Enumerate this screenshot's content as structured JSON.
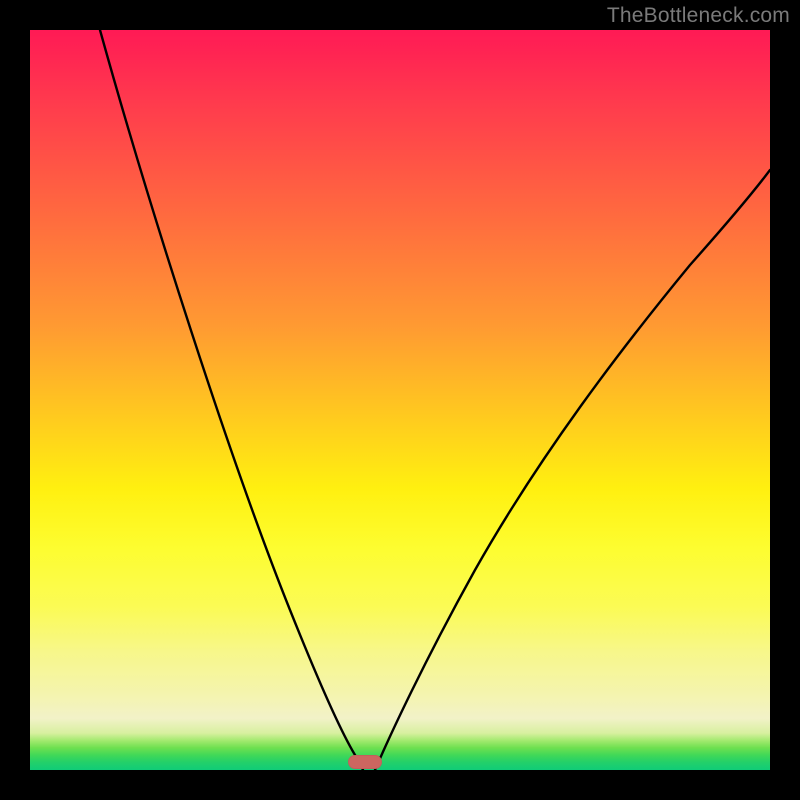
{
  "watermark": "TheBottleneck.com",
  "colors": {
    "frame": "#000000",
    "gradient_top": "#ff1a55",
    "gradient_mid": "#fff010",
    "gradient_bottom": "#10cc78",
    "curve": "#000000",
    "marker": "#cc6660"
  },
  "chart_data": {
    "type": "line",
    "title": "",
    "xlabel": "",
    "ylabel": "",
    "x": [
      0,
      0.05,
      0.1,
      0.15,
      0.2,
      0.25,
      0.3,
      0.35,
      0.4,
      0.45,
      0.5,
      0.55,
      0.6,
      0.65,
      0.7,
      0.75,
      0.8,
      0.85,
      0.9,
      0.95,
      1.0
    ],
    "xlim": [
      0,
      1
    ],
    "ylim": [
      0,
      1
    ],
    "series": [
      {
        "name": "left-branch",
        "values": [
          1.0,
          0.9,
          0.78,
          0.67,
          0.56,
          0.44,
          0.33,
          0.22,
          0.1,
          0.0,
          null,
          null,
          null,
          null,
          null,
          null,
          null,
          null,
          null,
          null,
          null
        ],
        "stroke": "#000000"
      },
      {
        "name": "right-branch",
        "values": [
          null,
          null,
          null,
          null,
          null,
          null,
          null,
          null,
          null,
          0.0,
          0.14,
          0.27,
          0.38,
          0.48,
          0.57,
          0.64,
          0.7,
          0.76,
          0.8,
          0.84,
          0.88
        ],
        "stroke": "#000000"
      }
    ],
    "annotations": [
      {
        "kind": "marker",
        "x": 0.45,
        "y": 0.0,
        "label": ""
      }
    ],
    "legend": false,
    "grid": false
  }
}
